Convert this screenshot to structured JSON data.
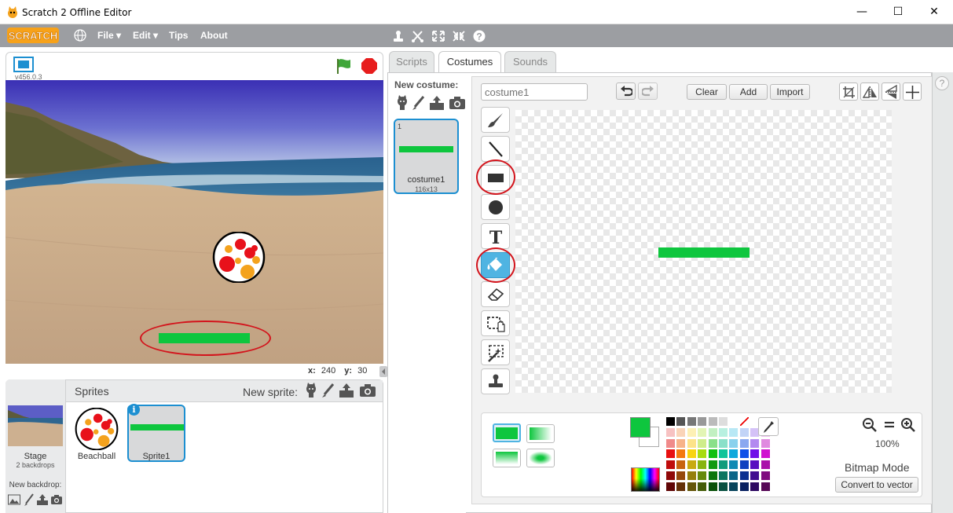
{
  "window": {
    "title": "Scratch 2 Offline Editor",
    "minimize": "—",
    "maximize": "☐",
    "close": "✕"
  },
  "menu": {
    "logo": "SCRATCH",
    "file": "File ▾",
    "edit": "Edit ▾",
    "tips": "Tips",
    "about": "About"
  },
  "stage": {
    "version": "v456.0.3",
    "x_label": "x:",
    "x_value": "240",
    "y_label": "y:",
    "y_value": "30"
  },
  "sprites": {
    "header": "Sprites",
    "new_sprite_label": "New sprite:",
    "stage_label": "Stage",
    "backdrops": "2 backdrops",
    "new_backdrop_label": "New backdrop:",
    "items": [
      {
        "name": "Beachball"
      },
      {
        "name": "Sprite1"
      }
    ],
    "info_badge": "i"
  },
  "tabs": [
    "Scripts",
    "Costumes",
    "Sounds"
  ],
  "costumes": {
    "new_costume_label": "New costume:",
    "items": [
      {
        "number": "1",
        "name": "costume1",
        "size": "116x13"
      }
    ]
  },
  "paint": {
    "costume_name_placeholder": "costume1",
    "clear": "Clear",
    "add": "Add",
    "import": "Import",
    "zoom": "100%",
    "mode": "Bitmap Mode",
    "convert": "Convert to vector",
    "primary_color": "#0ec63e",
    "help": "?"
  }
}
